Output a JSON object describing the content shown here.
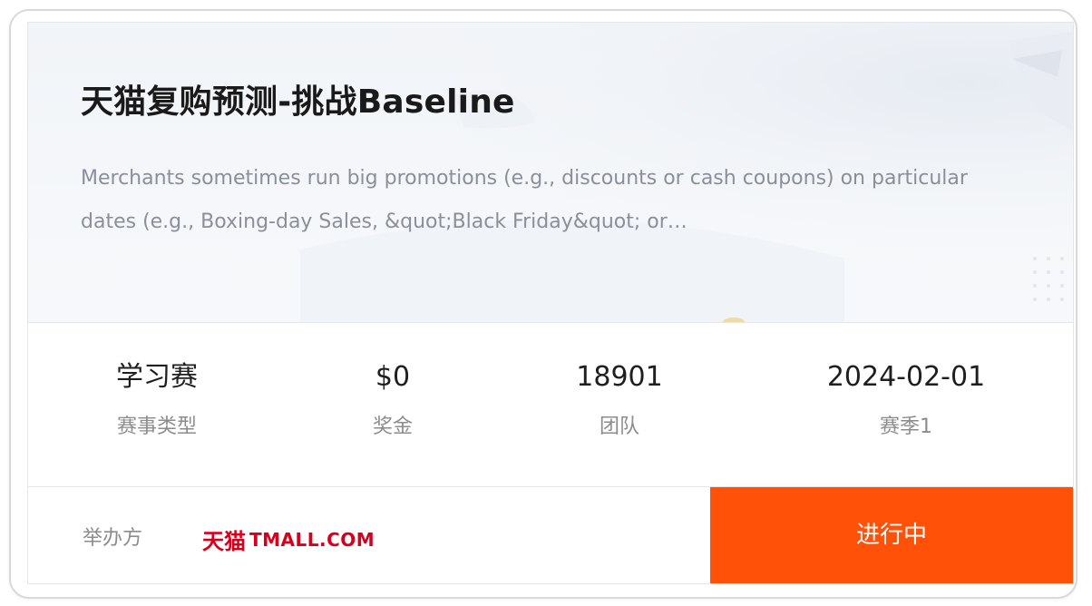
{
  "competition": {
    "title": "天猫复购预测-挑战Baseline",
    "description": "Merchants sometimes run big promotions (e.g., discounts or cash coupons) on particular dates (e.g., Boxing-day Sales, &quot;Black Friday&quot; or…"
  },
  "stats": [
    {
      "value": "学习赛",
      "label": "赛事类型"
    },
    {
      "value": "$0",
      "label": "奖金"
    },
    {
      "value": "18901",
      "label": "团队"
    },
    {
      "value": "2024-02-01",
      "label": "赛季1"
    }
  ],
  "footer": {
    "host_label": "举办方",
    "host_logo_cn": "天猫",
    "host_logo_en": "TMALL.COM",
    "status": "进行中"
  },
  "colors": {
    "accent": "#ff5208",
    "brand_tmall": "#d6001c"
  }
}
